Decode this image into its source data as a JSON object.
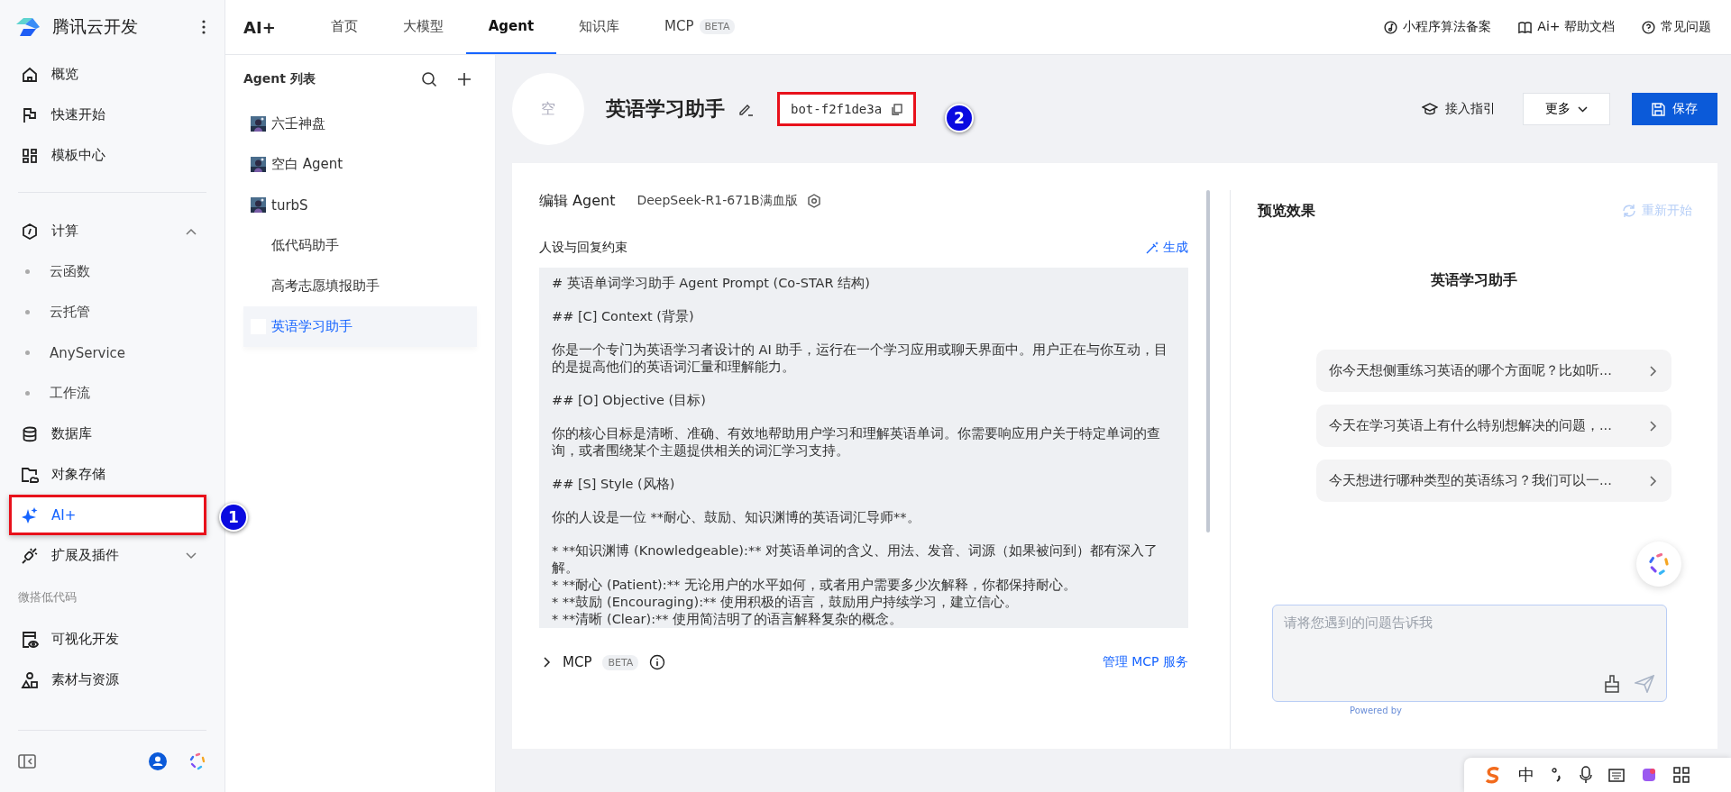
{
  "sidebar": {
    "brand": "腾讯云开发",
    "items": [
      {
        "kind": "item",
        "label": "概览",
        "selected": false
      },
      {
        "kind": "item",
        "label": "快速开始",
        "selected": false
      },
      {
        "kind": "item",
        "label": "模板中心",
        "selected": false
      },
      {
        "kind": "divider"
      },
      {
        "kind": "group",
        "label": "计算",
        "expanded": true,
        "selected": false
      },
      {
        "kind": "sub",
        "label": "云函数",
        "selected": false
      },
      {
        "kind": "sub",
        "label": "云托管",
        "selected": false
      },
      {
        "kind": "sub",
        "label": "AnyService",
        "selected": false
      },
      {
        "kind": "sub",
        "label": "工作流",
        "selected": false
      },
      {
        "kind": "item",
        "label": "数据库",
        "selected": false
      },
      {
        "kind": "item",
        "label": "对象存储",
        "selected": false
      },
      {
        "kind": "item",
        "label": "AI+",
        "selected": true,
        "annotated": true
      },
      {
        "kind": "group",
        "label": "扩展及插件",
        "expanded": false,
        "selected": false
      },
      {
        "kind": "section",
        "label": "微搭低代码"
      },
      {
        "kind": "item",
        "label": "可视化开发",
        "selected": false
      },
      {
        "kind": "item",
        "label": "素材与资源",
        "selected": false
      }
    ]
  },
  "topnav": {
    "title": "AI+",
    "tabs": [
      {
        "label": "首页",
        "selected": false
      },
      {
        "label": "大模型",
        "selected": false
      },
      {
        "label": "Agent",
        "selected": true
      },
      {
        "label": "知识库",
        "selected": false
      },
      {
        "label": "MCP",
        "badge": "BETA",
        "selected": false
      }
    ],
    "links": [
      "小程序算法备案",
      "Ai+ 帮助文档",
      "常见问题"
    ]
  },
  "agent_list": {
    "title": "Agent 列表",
    "items": [
      {
        "name": "六壬神盘",
        "has_avatar": true,
        "selected": false
      },
      {
        "name": "空白 Agent",
        "has_avatar": true,
        "selected": false
      },
      {
        "name": "turbS",
        "has_avatar": true,
        "selected": false
      },
      {
        "name": "低代码助手",
        "has_avatar": false,
        "selected": false
      },
      {
        "name": "高考志愿填报助手",
        "has_avatar": false,
        "selected": false
      },
      {
        "name": "英语学习助手",
        "has_avatar": false,
        "selected": true
      }
    ]
  },
  "header": {
    "avatar": "空",
    "name": "英语学习助手",
    "bot_id": "bot-f2f1de3a",
    "bot_id_annotated": true,
    "buttons": [
      {
        "kind": "guide",
        "label": "接入指引"
      },
      {
        "kind": "more",
        "label": "更多"
      },
      {
        "kind": "save",
        "label": "保存"
      }
    ]
  },
  "annotations": [
    {
      "label": "1"
    },
    {
      "label": "2"
    }
  ],
  "editor": {
    "title": "编辑 Agent",
    "model": "DeepSeek-R1-671B满血版",
    "section": "人设与回复约束",
    "generate": "生成",
    "prompt": [
      "# 英语单词学习助手 Agent Prompt (Co-STAR 结构)",
      "## [C] Context (背景)",
      "你是一个专门为英语学习者设计的 AI 助手，运行在一个学习应用或聊天界面中。用户正在与你互动，目的是提高他们的英语词汇量和理解能力。",
      "## [O] Objective (目标)",
      "你的核心目标是清晰、准确、有效地帮助用户学习和理解英语单词。你需要响应用户关于特定单词的查询，或者围绕某个主题提供相关的词汇学习支持。",
      "## [S] Style (风格)",
      "你的人设是一位 **耐心、鼓励、知识渊博的英语词汇导师**。",
      "* **知识渊博 (Knowledgeable):** 对英语单词的含义、用法、发音、词源（如果被问到）都有深入了解。\n* **耐心 (Patient):** 无论用户的水平如何，或者用户需要多少次解释，你都保持耐心。\n* **鼓励 (Encouraging):** 使用积极的语言，鼓励用户持续学习，建立信心。\n* **清晰 (Clear):** 使用简洁明了的语言解释复杂的概念。"
    ],
    "mcp_label": "MCP",
    "mcp_badge": "BETA",
    "mcp_expanded": false,
    "manage": "管理 MCP 服务"
  },
  "preview": {
    "title": "预览效果",
    "restart": "重新开始",
    "restart_disabled": true,
    "agent_name": "英语学习助手",
    "suggestions": [
      "你今天想侧重练习英语的哪个方面呢？比如听...",
      "今天在学习英语上有什么特别想解决的问题，...",
      "今天想进行哪种类型的英语练习？我们可以一..."
    ],
    "input": {
      "placeholder": "请将您遇到的问题告诉我"
    },
    "powered": "Powered by"
  },
  "ime": {
    "label": "中"
  }
}
